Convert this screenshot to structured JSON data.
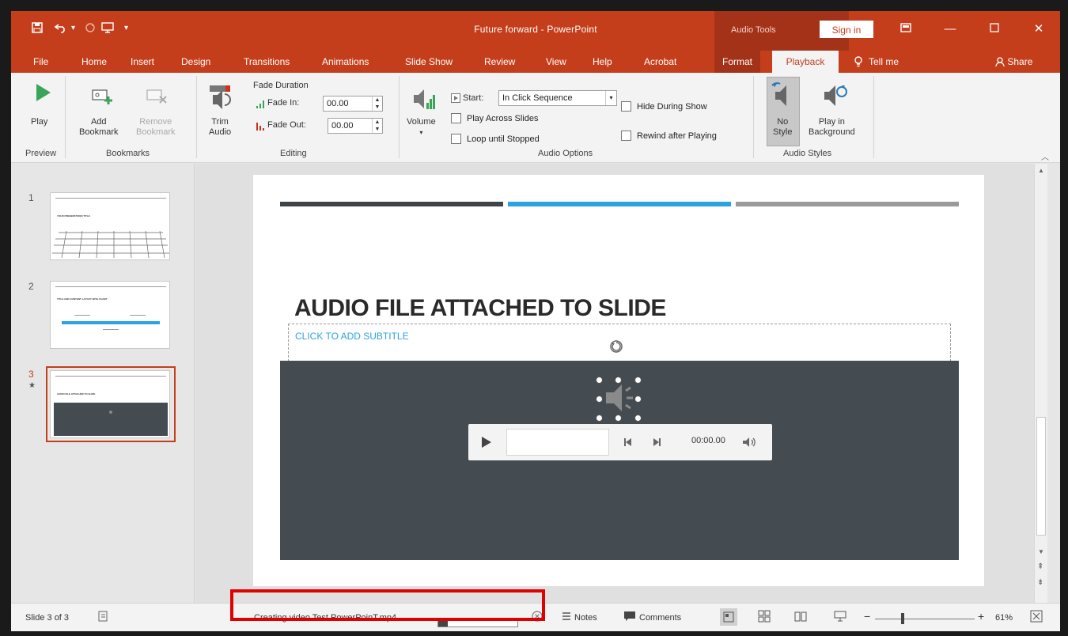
{
  "app": {
    "title": "Future forward  -  PowerPoint",
    "context_tab_group": "Audio Tools",
    "sign_in_label": "Sign in",
    "accent_color": "#c43e1c"
  },
  "quick_access": {
    "icons": [
      "save-icon",
      "undo-icon",
      "redo-icon",
      "start-from-beginning-icon",
      "customize-icon"
    ]
  },
  "window_controls": [
    "ribbon-display-icon",
    "minimize-icon",
    "maximize-icon",
    "close-icon"
  ],
  "tabs": [
    {
      "label": "File"
    },
    {
      "label": "Home"
    },
    {
      "label": "Insert"
    },
    {
      "label": "Design"
    },
    {
      "label": "Transitions"
    },
    {
      "label": "Animations"
    },
    {
      "label": "Slide Show"
    },
    {
      "label": "Review"
    },
    {
      "label": "View"
    },
    {
      "label": "Help"
    },
    {
      "label": "Acrobat"
    },
    {
      "label": "Format"
    },
    {
      "label": "Playback",
      "active": true
    }
  ],
  "tell_me_label": "Tell me",
  "share_label": "Share",
  "ribbon": {
    "preview": {
      "group_label": "Preview",
      "play_label": "Play"
    },
    "bookmarks": {
      "group_label": "Bookmarks",
      "add_line1": "Add",
      "add_line2": "Bookmark",
      "remove_line1": "Remove",
      "remove_line2": "Bookmark"
    },
    "editing": {
      "group_label": "Editing",
      "trim_line1": "Trim",
      "trim_line2": "Audio",
      "fade_duration_label": "Fade Duration",
      "fade_in_label": "Fade In:",
      "fade_in_value": "00.00",
      "fade_out_label": "Fade Out:",
      "fade_out_value": "00.00"
    },
    "audio_options": {
      "group_label": "Audio Options",
      "volume_label": "Volume",
      "start_label": "Start:",
      "start_value": "In Click Sequence",
      "play_across_slides": "Play Across Slides",
      "loop_until_stopped": "Loop until Stopped",
      "hide_during_show": "Hide During Show",
      "rewind_after_playing": "Rewind after Playing"
    },
    "audio_styles": {
      "group_label": "Audio Styles",
      "no_style_line1": "No",
      "no_style_line2": "Style",
      "play_bg_line1": "Play in",
      "play_bg_line2": "Background"
    }
  },
  "thumbnails": [
    {
      "number": "1",
      "title": "YOUR PRESENTATION TITLE"
    },
    {
      "number": "2",
      "title": "TITLE AND CONTENT LAYOUT WITH CHART"
    },
    {
      "number": "3",
      "title": "AUDIO FILE ATTACHED TO SLIDE",
      "selected": true
    }
  ],
  "slide": {
    "title": "AUDIO FILE ATTACHED TO SLIDE",
    "subtitle_placeholder": "CLICK TO ADD SUBTITLE",
    "bar_colors": [
      "#3f4448",
      "#2aa3e3",
      "#9a9a9a"
    ],
    "panel_color": "#444c51",
    "player_time": "00:00.00"
  },
  "status": {
    "slide_info": "Slide 3 of 3",
    "progress_text": "Creating video Test PowerPoinT.mp4",
    "progress_fraction": 0.12,
    "notes_label": "Notes",
    "comments_label": "Comments",
    "zoom_level": "61%"
  }
}
